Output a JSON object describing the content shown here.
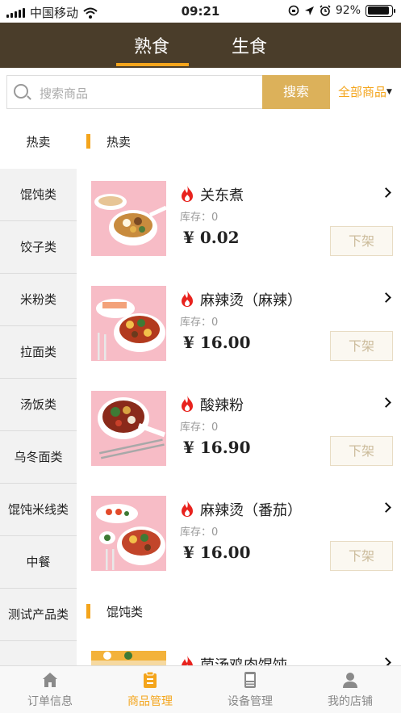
{
  "status_bar": {
    "carrier": "中国移动",
    "time": "09:21",
    "battery": "92%"
  },
  "header": {
    "tabs": [
      {
        "label": "熟食",
        "active": true
      },
      {
        "label": "生食",
        "active": false
      }
    ]
  },
  "search": {
    "placeholder": "搜索商品",
    "button_label": "搜索",
    "filter_label": "全部商品",
    "filter_caret": "▼"
  },
  "sidebar": {
    "items": [
      {
        "label": "热卖",
        "active": true
      },
      {
        "label": "馄饨类"
      },
      {
        "label": "饺子类"
      },
      {
        "label": "米粉类"
      },
      {
        "label": "拉面类"
      },
      {
        "label": "汤饭类"
      },
      {
        "label": "乌冬面类"
      },
      {
        "label": "馄饨米线类"
      },
      {
        "label": "中餐"
      },
      {
        "label": "测试产品类"
      },
      {
        "label": ""
      }
    ]
  },
  "content": {
    "sections": [
      {
        "title": "热卖",
        "items": [
          {
            "name": "关东煮",
            "stock": "库存：0",
            "price": "¥ 0.02",
            "action": "下架"
          },
          {
            "name": "麻辣烫（麻辣）",
            "stock": "库存：0",
            "price": "¥ 16.00",
            "action": "下架"
          },
          {
            "name": "酸辣粉",
            "stock": "库存：0",
            "price": "¥ 16.90",
            "action": "下架"
          },
          {
            "name": "麻辣烫（番茄）",
            "stock": "库存：0",
            "price": "¥ 16.00",
            "action": "下架"
          }
        ]
      },
      {
        "title": "馄饨类",
        "items": [
          {
            "name": "菌汤鸡肉馄饨",
            "stock": "",
            "price": "",
            "action": ""
          }
        ]
      }
    ]
  },
  "tabbar": {
    "tabs": [
      {
        "label": "订单信息",
        "icon": "home-icon"
      },
      {
        "label": "商品管理",
        "icon": "clipboard-icon",
        "active": true
      },
      {
        "label": "设备管理",
        "icon": "device-icon"
      },
      {
        "label": "我的店铺",
        "icon": "user-icon"
      }
    ]
  },
  "colors": {
    "header_bg": "#4a3d2a",
    "accent": "#f4a51c",
    "search_button": "#dcb15a",
    "fire": "#e8231e"
  }
}
